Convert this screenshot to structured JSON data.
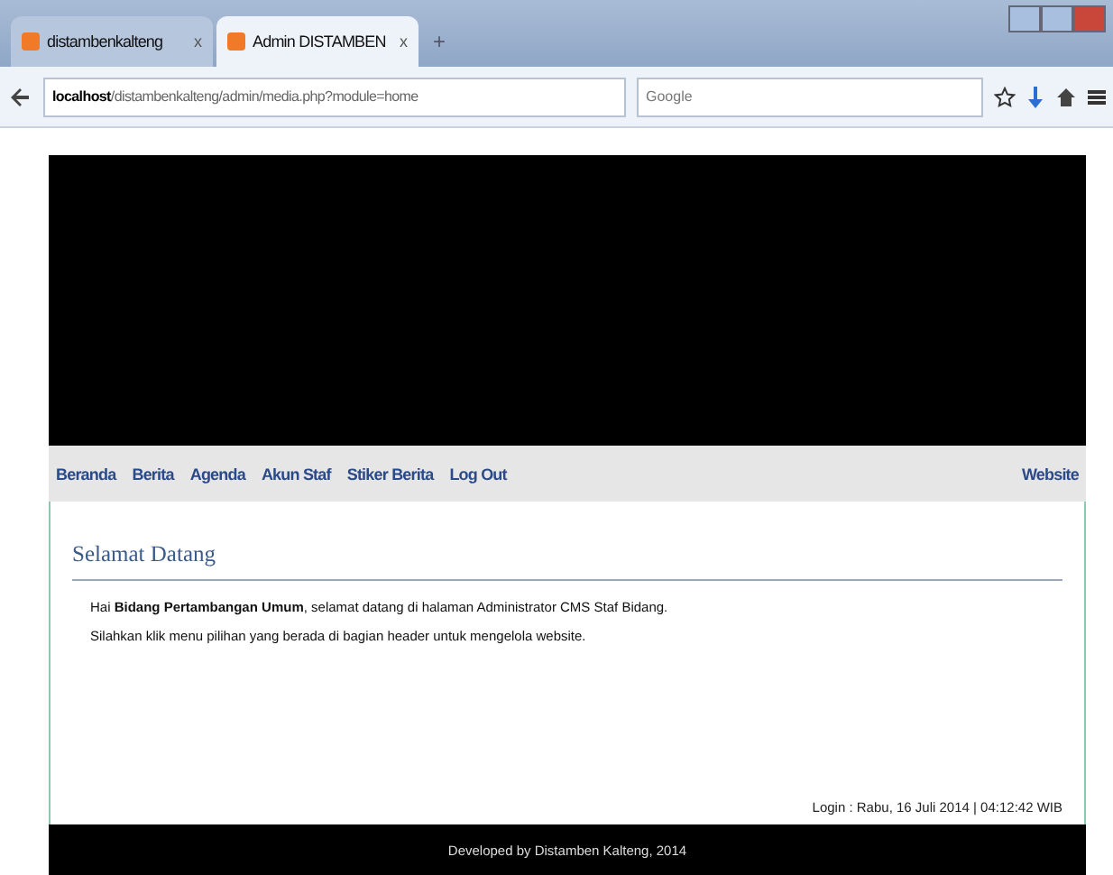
{
  "browser": {
    "tabs": [
      {
        "label": "distambenkalteng",
        "selected": false,
        "close": "x"
      },
      {
        "label": "Admin DISTAMBEN",
        "selected": true,
        "close": "x"
      }
    ],
    "new_tab": "+",
    "address": {
      "host": "localhost",
      "path": "/distambenkalteng/admin/media.php?module=home"
    },
    "search": {
      "placeholder": "Google"
    }
  },
  "menu": {
    "items": [
      "Beranda",
      "Berita",
      "Agenda",
      "Akun Staf",
      "Stiker Berita",
      "Log Out"
    ],
    "right": "Website"
  },
  "content": {
    "title": "Selamat Datang",
    "paragraphs": [
      "Hai **Bidang Pertambangan Umum**, selamat datang di halaman Administrator CMS Staf Bidang.",
      "Silahkan klik menu pilihan yang berada di bagian header untuk mengelola website."
    ],
    "login": "Login : Rabu, 16 Juli 2014 | 04:12:42 WIB"
  },
  "footer": "Developed by Distamben Kalteng, 2014"
}
